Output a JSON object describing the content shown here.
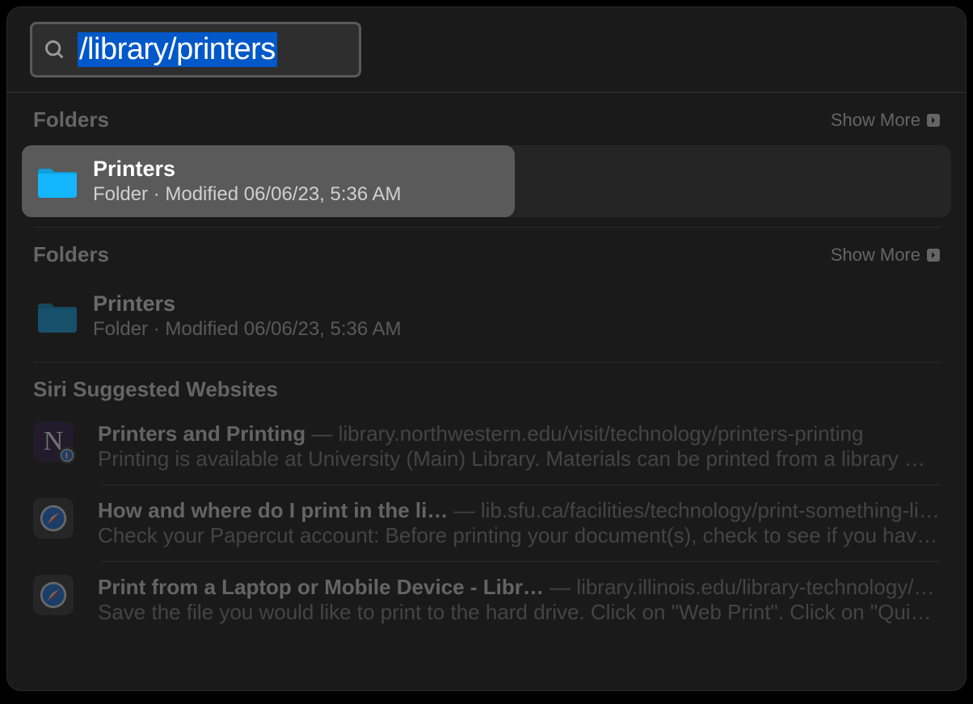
{
  "search": {
    "query": "/library/printers"
  },
  "sections": [
    {
      "title": "Folders",
      "show_more_label": "Show More",
      "items": [
        {
          "title": "Printers",
          "subtitle": "Folder · Modified 06/06/23, 5:36 AM",
          "selected": true,
          "icon": "folder"
        }
      ]
    },
    {
      "title": "Folders",
      "show_more_label": "Show More",
      "items": [
        {
          "title": "Printers",
          "subtitle": "Folder · Modified 06/06/23, 5:36 AM",
          "selected": false,
          "icon": "folder"
        }
      ]
    }
  ],
  "siri_section": {
    "title": "Siri Suggested Websites",
    "items": [
      {
        "title": "Printers and Printing",
        "url": "library.northwestern.edu/visit/technology/printers-printing",
        "description": "Printing is available at University (Main) Library. Materials can be printed from a library work…",
        "icon_type": "nu"
      },
      {
        "title": "How and where do I print in the li…",
        "url": "lib.sfu.ca/facilities/technology/print-something-library",
        "description": "Check your Papercut account: Before printing your document(s), check to see if you have e…",
        "icon_type": "safari"
      },
      {
        "title": "Print from a Laptop or Mobile Device - Libr…",
        "url": "library.illinois.edu/library-technology/print/",
        "description": "Save the file you would like to print to the hard drive. Click on \"Web Print\". Click on \"Quick s…",
        "icon_type": "safari"
      }
    ]
  }
}
